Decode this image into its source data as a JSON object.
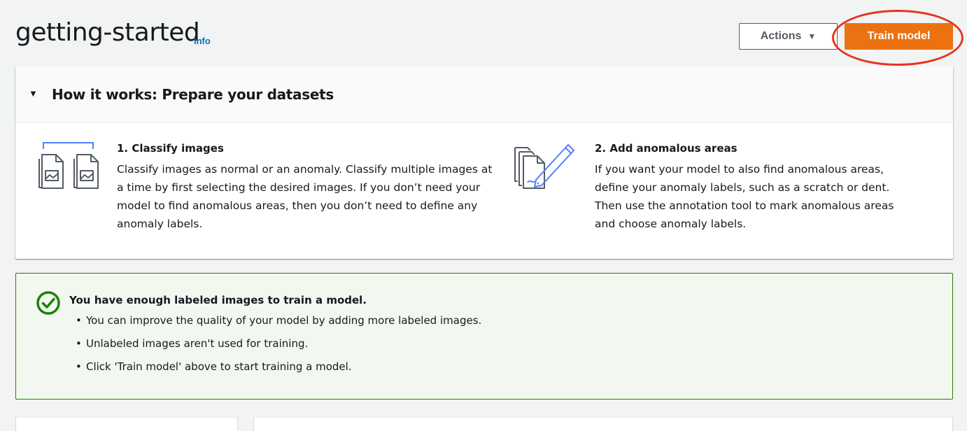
{
  "header": {
    "title": "getting-started",
    "info_link": "Info",
    "actions_label": "Actions",
    "train_label": "Train model"
  },
  "how_it_works": {
    "title": "How it works: Prepare your datasets",
    "steps": [
      {
        "title": "1. Classify images",
        "lines": [
          "Classify images as normal or an anomaly. Classify multiple images at",
          "a time by first selecting the desired images. If you don’t need your",
          "model to find anomalous areas, then you don’t need to define any",
          "anomaly labels."
        ],
        "icon": "classify-images-icon"
      },
      {
        "title": "2. Add anomalous areas",
        "lines": [
          "If you want your model to also find anomalous areas,",
          "define your anomaly labels, such as a scratch or dent.",
          "Then use the annotation tool to mark anomalous areas",
          "and choose anomaly labels."
        ],
        "icon": "annotate-images-icon"
      }
    ]
  },
  "alert": {
    "type": "success",
    "title": "You have enough labeled images to train a model.",
    "items": [
      "You can improve the quality of your model by adding more labeled images.",
      "Unlabeled images aren't used for training.",
      "Click 'Train model' above to start training a model."
    ]
  },
  "colors": {
    "primary_button": "#ec7211",
    "highlight_ring": "#e8331e",
    "success_border": "#1d8102",
    "success_bg": "#f2f8f0",
    "link": "#0073bb",
    "icon_accent": "#527fff"
  }
}
